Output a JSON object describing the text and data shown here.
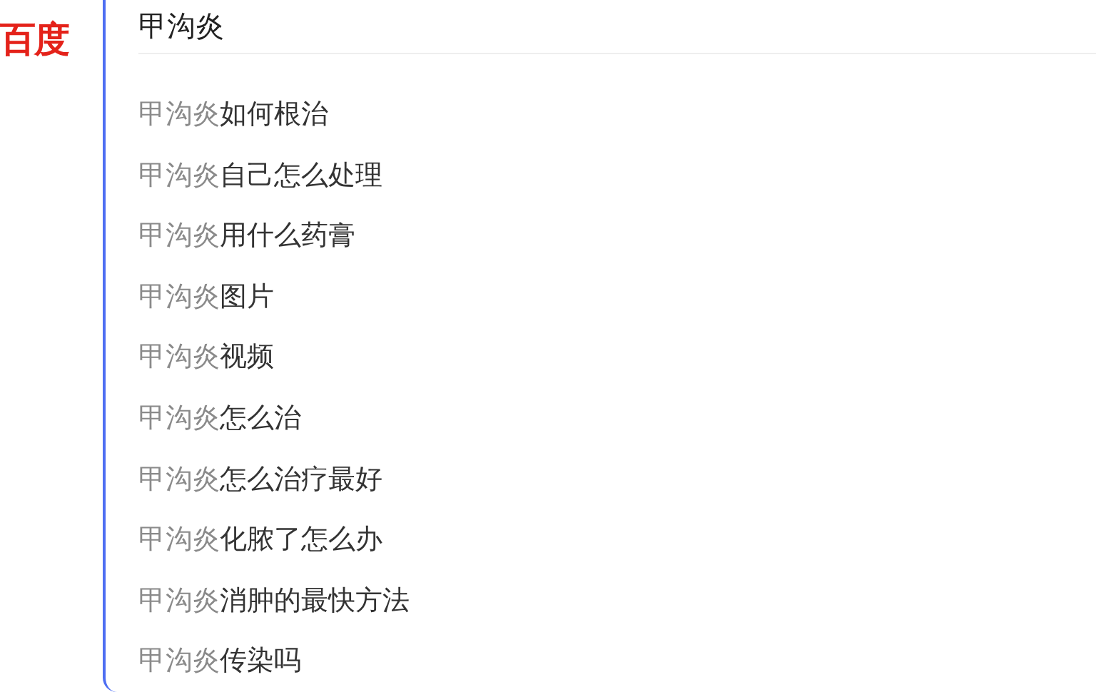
{
  "logo": "百度",
  "search": {
    "value": "甲沟炎"
  },
  "suggestions": [
    {
      "match": "甲沟炎",
      "rest": "如何根治"
    },
    {
      "match": "甲沟炎",
      "rest": "自己怎么处理"
    },
    {
      "match": "甲沟炎",
      "rest": "用什么药膏"
    },
    {
      "match": "甲沟炎",
      "rest": "图片"
    },
    {
      "match": "甲沟炎",
      "rest": "视频"
    },
    {
      "match": "甲沟炎",
      "rest": "怎么治"
    },
    {
      "match": "甲沟炎",
      "rest": "怎么治疗最好"
    },
    {
      "match": "甲沟炎",
      "rest": "化脓了怎么办"
    },
    {
      "match": "甲沟炎",
      "rest": "消肿的最快方法"
    },
    {
      "match": "甲沟炎",
      "rest": "传染吗"
    }
  ]
}
